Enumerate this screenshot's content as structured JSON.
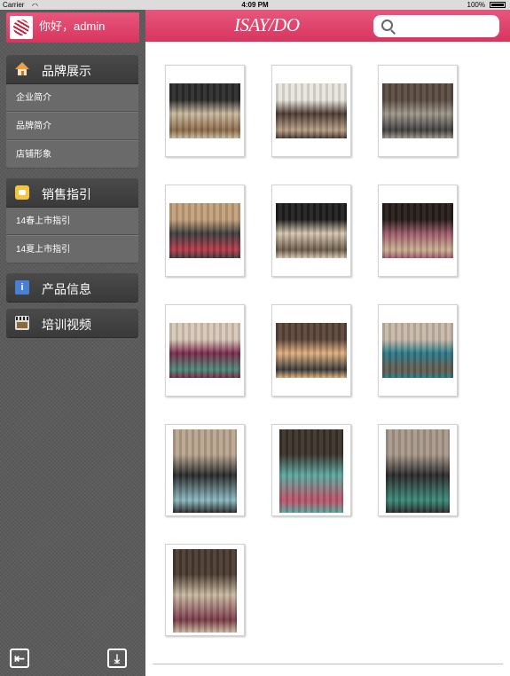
{
  "status_bar": {
    "carrier": "Carrier",
    "time": "4:09 PM",
    "battery": "100%"
  },
  "user": {
    "greeting": "你好，admin"
  },
  "sidebar": {
    "groups": [
      {
        "label": "品牌展示",
        "icon": "home-icon",
        "items": [
          "企业简介",
          "品牌简介",
          "店铺形象"
        ]
      },
      {
        "label": "销售指引",
        "icon": "chat-icon",
        "items": [
          "14春上市指引",
          "14夏上市指引"
        ]
      },
      {
        "label": "产品信息",
        "icon": "info-icon",
        "items": []
      },
      {
        "label": "培训视频",
        "icon": "film-icon",
        "items": []
      }
    ],
    "logout_icon": "logout-icon",
    "download_icon": "download-icon"
  },
  "header": {
    "logo": "ISAY/DO",
    "search_value": ""
  },
  "gallery": {
    "photos": [
      {
        "orientation": "landscape",
        "tones": [
          "#2b2b2b",
          "#c9b9a0",
          "#8a6a48"
        ]
      },
      {
        "orientation": "landscape",
        "tones": [
          "#e9e6df",
          "#4a3a32",
          "#b79e86"
        ]
      },
      {
        "orientation": "landscape",
        "tones": [
          "#5a4a40",
          "#9e968a",
          "#3f3f3f"
        ]
      },
      {
        "orientation": "landscape",
        "tones": [
          "#c3a17a",
          "#3d3d3d",
          "#b83a4a"
        ]
      },
      {
        "orientation": "landscape",
        "tones": [
          "#1e1e1e",
          "#d6c6b0",
          "#6a5a4a"
        ]
      },
      {
        "orientation": "landscape",
        "tones": [
          "#251c18",
          "#9e5a6a",
          "#c9b090"
        ]
      },
      {
        "orientation": "landscape",
        "tones": [
          "#d8c8b8",
          "#7a2a4a",
          "#4a8a7a"
        ]
      },
      {
        "orientation": "landscape",
        "tones": [
          "#5a4438",
          "#e0b080",
          "#3a3a3a"
        ]
      },
      {
        "orientation": "landscape",
        "tones": [
          "#c8b8a8",
          "#2a7a8a",
          "#6a5a4a"
        ]
      },
      {
        "orientation": "portrait",
        "tones": [
          "#b9a58e",
          "#2a2a2a",
          "#8ab8c0"
        ]
      },
      {
        "orientation": "portrait",
        "tones": [
          "#3a322a",
          "#5aa8a0",
          "#c0506a"
        ]
      },
      {
        "orientation": "portrait",
        "tones": [
          "#a8988a",
          "#2a2a2a",
          "#3a8a7a"
        ]
      },
      {
        "orientation": "portrait",
        "tones": [
          "#4a3a30",
          "#c8b8a0",
          "#7a3a4a"
        ]
      }
    ]
  },
  "colors": {
    "accent": "#dd3f68",
    "sidebar": "#5b5b5b"
  }
}
